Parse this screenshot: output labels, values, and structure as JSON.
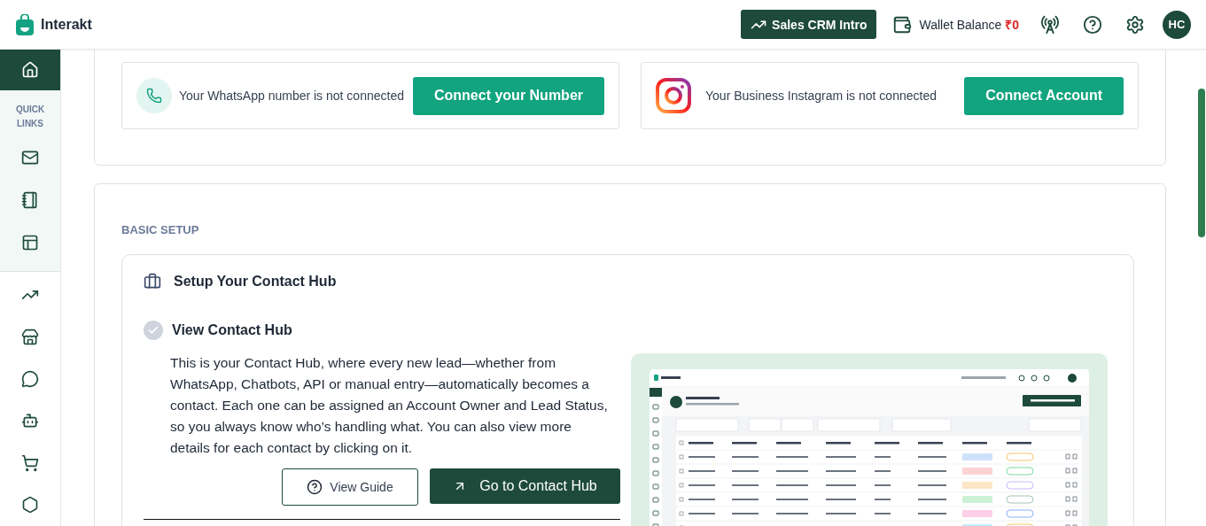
{
  "header": {
    "brand": "Interakt",
    "crm_button": "Sales CRM Intro",
    "wallet_label": "Wallet Balance",
    "wallet_amount": "₹0",
    "avatar": "HC"
  },
  "sidebar": {
    "home": {
      "selected": true
    },
    "quick_links_label": "QUICK LINKS",
    "quick_links": [
      {
        "selected": false
      },
      {
        "selected": false
      },
      {
        "selected": false
      }
    ],
    "items": [
      {
        "selected": false
      },
      {
        "selected": false
      },
      {
        "selected": false
      },
      {
        "selected": false
      },
      {
        "selected": false
      },
      {
        "selected": false
      }
    ]
  },
  "connections": [
    {
      "kind": "whatsapp",
      "text": "Your WhatsApp number is not connected",
      "button": "Connect your Number"
    },
    {
      "kind": "instagram",
      "text": "Your Business Instagram is not connected",
      "button": "Connect Account"
    }
  ],
  "basic_setup": {
    "heading": "BASIC SETUP",
    "card_title": "Setup Your Contact Hub",
    "step": {
      "title": "View Contact Hub",
      "done": true,
      "description": "This is your Contact Hub, where every new lead—whether from WhatsApp, Chatbots, API or manual entry—automatically becomes a contact. Each one can be assigned an Account Owner and Lead Status, so you always know who’s handling what. You can also view more details for each contact by clicking on it.",
      "guide_button": "View Guide",
      "go_button": "Go to Contact Hub"
    }
  }
}
